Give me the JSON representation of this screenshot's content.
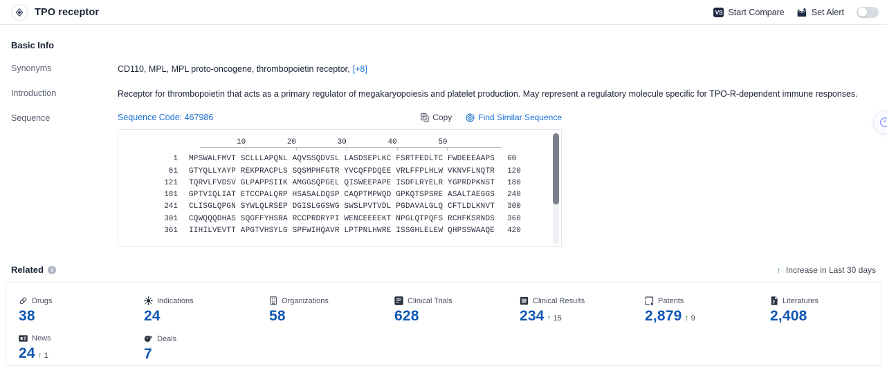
{
  "header": {
    "title": "TPO receptor",
    "title_icon": "target-icon",
    "start_compare_label": "Start Compare",
    "start_compare_icon": "vs-icon",
    "vs_badge_text": "VS",
    "set_alert_label": "Set Alert",
    "set_alert_icon": "alert-mail-icon",
    "alert_toggle_state": "off"
  },
  "basic_info": {
    "section_title": "Basic Info",
    "synonyms_label": "Synonyms",
    "synonyms_value": "CD110,  MPL,  MPL proto-oncogene, thrombopoietin receptor,",
    "synonyms_more": "[+8]",
    "introduction_label": "Introduction",
    "introduction_value": "Receptor for thrombopoietin that acts as a primary regulator of megakaryopoiesis and platelet production. May represent a regulatory molecule specific for TPO-R-dependent immune responses.",
    "sequence_label": "Sequence"
  },
  "sequence": {
    "code_label": "Sequence Code: 467986",
    "copy_label": "Copy",
    "copy_icon": "copy-icon",
    "find_similar_label": "Find Similar Sequence",
    "find_similar_icon": "find-similar-icon",
    "ruler_ticks": [
      10,
      20,
      30,
      40,
      50
    ],
    "rows": [
      {
        "start": "1",
        "blocks": "MPSWALFMVT SCLLLAPQNL AQVSSQDVSL LASDSEPLKC FSRTFEDLTC FWDEEEAAPS",
        "end": "60"
      },
      {
        "start": "61",
        "blocks": "GTYQLLYAYP REKPRACPLS SQSMPHFGTR YVCQFPDQEE VRLFFPLHLW VKNVFLNQTR",
        "end": "120"
      },
      {
        "start": "121",
        "blocks": "TQRVLFVDSV GLPAPPSIIK AMGGSQPGEL QISWEEPAPE ISDFLRYELR YGPRDPKNST",
        "end": "180"
      },
      {
        "start": "181",
        "blocks": "GPTVIQLIAT ETCCPALQRP HSASALDQSP CAQPTMPWQD GPKQTSPSRE ASALTAEGGS",
        "end": "240"
      },
      {
        "start": "241",
        "blocks": "CLISGLQPGN SYWLQLRSEP DGISLGGSWG SWSLPVTVDL PGDAVALGLQ CFTLDLKNVT",
        "end": "300"
      },
      {
        "start": "301",
        "blocks": "CQWQQQDHAS SQGFFYHSRA RCCPRDRYPI WENCEEEEKT NPGLQTPQFS RCHFKSRNDS",
        "end": "360"
      },
      {
        "start": "361",
        "blocks": "IIHILVEVTT APGTVHSYLG SPFWIHQAVR LPTPNLHWRE ISSGHLELEW QHPSSWAAQE",
        "end": "420"
      }
    ]
  },
  "related": {
    "title": "Related",
    "info_icon": "info-icon",
    "info_glyph": "i",
    "legend_text": "Increase in Last 30 days",
    "legend_icon": "arrow-up-icon",
    "cards": [
      {
        "label": "Drugs",
        "icon": "pill-icon",
        "value": "38",
        "delta": null
      },
      {
        "label": "Indications",
        "icon": "virus-icon",
        "value": "24",
        "delta": null
      },
      {
        "label": "Organizations",
        "icon": "building-icon",
        "value": "58",
        "delta": null
      },
      {
        "label": "Clinical Trials",
        "icon": "clinical-trial-icon",
        "value": "628",
        "delta": null
      },
      {
        "label": "Clinical Results",
        "icon": "clinical-result-icon",
        "value": "234",
        "delta": "15"
      },
      {
        "label": "Patents",
        "icon": "patent-icon",
        "value": "2,879",
        "delta": "9"
      },
      {
        "label": "Literatures",
        "icon": "literature-icon",
        "value": "2,408",
        "delta": null
      },
      {
        "label": "News",
        "icon": "news-icon",
        "value": "24",
        "delta": "1"
      },
      {
        "label": "Deals",
        "icon": "deals-icon",
        "value": "7",
        "delta": null
      }
    ]
  },
  "colors": {
    "accent_blue": "#0f56b3",
    "link_blue": "#1a6fd4",
    "increase_green": "#1e7e34",
    "text_dark": "#1b2436",
    "text_muted": "#5a6170"
  }
}
